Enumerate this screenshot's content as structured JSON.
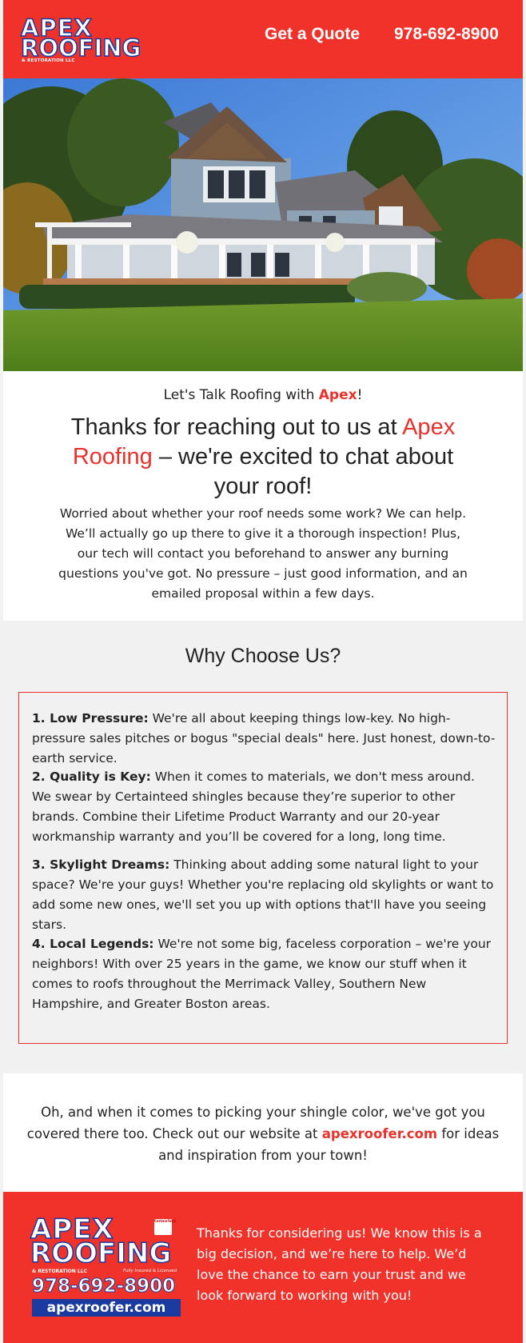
{
  "header": {
    "logo": {
      "line1": "APEX",
      "line2": "ROOFING",
      "line3": "& RESTORATION LLC"
    },
    "quote_label": "Get a Quote",
    "phone": "978-692-8900",
    "bg_color": "#f0322b"
  },
  "hero": {
    "alt": "House"
  },
  "intro": {
    "kicker_prefix": "Let's Talk Roofing with ",
    "kicker_brand": "Apex",
    "kicker_suffix": "!",
    "heading_prefix": "Thanks for reaching out to us at ",
    "heading_brand": "Apex Roofing",
    "heading_suffix": " – we're excited to chat about your roof!",
    "body": "Worried about whether your roof needs some work? We can help. We’ll actually go up there to give it a thorough inspection! Plus, our tech will contact you beforehand to answer any burning questions you've got. No pressure – just good information, and an emailed proposal within a few days."
  },
  "why": {
    "title": "Why Choose Us?",
    "reasons": [
      {
        "label": "1. Low Pressure:",
        "text": " We're all about keeping things low-key. No high-pressure sales pitches or bogus \"special deals\" here. Just honest, down-to-earth service."
      },
      {
        "label": "2. Quality is Key:",
        "text": " When it comes to materials, we don't mess around. We swear by Certainteed shingles because they’re superior to other brands. Combine their Lifetime Product Warranty and our 20-year workmanship warranty and you’ll be covered for a long, long time."
      },
      {
        "label": "3. Skylight Dreams:",
        "text": " Thinking about adding some natural light to your space? We're your guys! Whether you're replacing old skylights or want to add some new ones, we'll set you up with options that'll have you seeing stars."
      },
      {
        "label": "4. Local Legends:",
        "text": " We're not some big, faceless corporation – we're your neighbors! With over 25 years in the game, we know our stuff when it comes to roofs throughout the Merrimack Valley, Southern New Hampshire, and Greater Boston areas."
      }
    ]
  },
  "shingle": {
    "prefix": "Oh, and when it comes to picking your shingle color, we've got you covered there too. Check out our website at ",
    "link": "apexroofer.com",
    "suffix": " for ideas and inspiration from your town!"
  },
  "footer": {
    "logo": {
      "line1": "APEX",
      "line2": "ROOFING",
      "line3": "& RESTORATION LLC",
      "insured": "Fully Insured & Licensed",
      "badge": "CertainTeed",
      "phone": "978-692-8900",
      "site": "apexroofer.com"
    },
    "text": "Thanks for considering us! We know this is a big decision, and we’re here to help. We’d love the chance to earn your trust and we look forward to working with you!"
  }
}
